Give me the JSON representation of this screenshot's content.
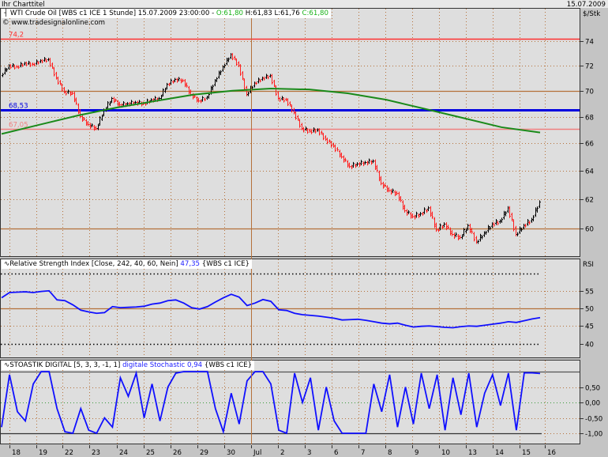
{
  "window": {
    "title": "Ihr Charttitel",
    "date": "15.07.2009"
  },
  "main_legend": {
    "icon": "candlestick-icon",
    "instrument": "WTI Crude Oil [WBS c1 ICE  1 Stunde] 15.07.2009 23:00:00 -",
    "open": "O:61,80",
    "high_low": "H:61,83 L:61,76",
    "close": "C:61,80",
    "copyright": "© www.tradesignalonline.com"
  },
  "rsi_legend": {
    "name": "Relative Strength Index [Close, 242, 40, 60, Nein]",
    "value": "47,35",
    "source": "{WBS c1 ICE}"
  },
  "stoch_legend": {
    "name": "STOASTIK DIGITAL [5, 3, 3, -1, 1]",
    "value": "digitale Stochastic 0,94",
    "source": "{WBS c1 ICE}"
  },
  "colors": {
    "up": "#000000",
    "down": "#ff2020",
    "ma": "#1a8a1a",
    "level_blue": "#0000e0",
    "level_red": "#ff3030",
    "level_pink": "#f08080",
    "brown": "#b5713a",
    "indicator": "#1010ff"
  },
  "chart_data": [
    {
      "type": "ohlc",
      "title": "WTI Crude Oil [WBS c1 ICE 1 Stunde]",
      "ylabel": "$/Stk",
      "yscale": "log",
      "ylim": [
        58.6,
        75.2
      ],
      "yticks": [
        "74",
        "72",
        "70",
        "68",
        "66",
        "64",
        "62",
        "60"
      ],
      "ytick_values": [
        74,
        72,
        70,
        68,
        66,
        64,
        62,
        60
      ],
      "x_labels": [
        "18",
        "19",
        "22",
        "23",
        "24",
        "25",
        "26",
        "29",
        "30",
        "Jul",
        "2",
        "3",
        "6",
        "7",
        "8",
        "9",
        "10",
        "13",
        "14",
        "15",
        "16"
      ],
      "closes": [
        71.2,
        72.0,
        71.9,
        72.2,
        72.1,
        72.4,
        72.5,
        71.0,
        69.9,
        69.8,
        68.0,
        67.4,
        67.1,
        68.5,
        69.4,
        68.9,
        69.0,
        69.1,
        69.0,
        69.3,
        69.4,
        70.5,
        70.9,
        70.8,
        69.7,
        69.2,
        69.5,
        70.8,
        71.9,
        72.9,
        72.0,
        69.7,
        70.6,
        71.0,
        71.2,
        69.4,
        69.3,
        68.3,
        67.1,
        66.9,
        67.0,
        66.3,
        65.8,
        65.0,
        64.3,
        64.5,
        64.6,
        64.7,
        63.1,
        62.6,
        62.4,
        61.2,
        60.8,
        61.0,
        61.4,
        59.9,
        60.3,
        59.6,
        59.4,
        60.2,
        59.1,
        59.7,
        60.3,
        60.5,
        61.4,
        59.6,
        60.2,
        60.6,
        61.8
      ],
      "moving_average": [
        66.7,
        67.4,
        68.1,
        68.7,
        69.2,
        69.7,
        70.0,
        70.17,
        70.1,
        69.8,
        69.3,
        68.6,
        67.9,
        67.2,
        66.8
      ],
      "levels": [
        {
          "value": 74.2,
          "label": "74,2",
          "color": "#ff3030"
        },
        {
          "value": 68.53,
          "label": "68,53",
          "color": "#0000e0"
        },
        {
          "value": 67.05,
          "label": "67,05",
          "color": "#f08080"
        }
      ],
      "brown_lines": [
        70,
        60
      ]
    },
    {
      "type": "line",
      "title": "Relative Strength Index",
      "ylabel": "RSI",
      "ylim": [
        36,
        63
      ],
      "yticks": [
        "55",
        "50",
        "45",
        "40"
      ],
      "ytick_values": [
        55,
        50,
        45,
        40
      ],
      "bands": [
        60,
        40
      ],
      "midline": 50,
      "values": [
        53,
        54.5,
        54.6,
        54.7,
        54.5,
        54.8,
        55,
        52.4,
        52.2,
        51,
        49.5,
        49,
        48.6,
        48.8,
        50.5,
        50.2,
        50.3,
        50.4,
        50.6,
        51.2,
        51.5,
        52.2,
        52.4,
        51.5,
        50.2,
        49.8,
        50.5,
        51.8,
        53,
        54,
        53.2,
        50.8,
        51.5,
        52.5,
        52,
        49.6,
        49.4,
        48.6,
        48.2,
        48,
        47.8,
        47.5,
        47.2,
        46.7,
        46.8,
        46.9,
        46.6,
        46.2,
        45.8,
        45.6,
        45.8,
        45.2,
        44.7,
        44.9,
        45,
        44.8,
        44.6,
        44.5,
        44.8,
        45,
        44.9,
        45.2,
        45.5,
        45.8,
        46.2,
        46,
        46.5,
        47,
        47.35
      ]
    },
    {
      "type": "line",
      "title": "digitale Stochastic",
      "ylim": [
        -1.3,
        1.4
      ],
      "yticks": [
        "0,50",
        "0,00",
        "-0,50",
        "-1,00"
      ],
      "ytick_values": [
        0.5,
        0,
        -0.5,
        -1
      ],
      "values": [
        -0.8,
        0.9,
        -0.3,
        -0.6,
        0.6,
        1.0,
        1.0,
        -0.2,
        -0.95,
        -1.0,
        -0.2,
        -0.9,
        -1.0,
        -0.5,
        -0.8,
        0.8,
        0.2,
        0.95,
        -0.5,
        0.6,
        -0.6,
        0.5,
        0.95,
        1.0,
        1.0,
        1.0,
        1.0,
        -0.2,
        -0.95,
        0.3,
        -0.7,
        0.7,
        1.0,
        1.0,
        0.6,
        -0.9,
        -1.0,
        0.95,
        0.0,
        0.8,
        -0.9,
        0.5,
        -0.6,
        -1.0,
        -1.0,
        -1.0,
        -1.0,
        0.6,
        -0.3,
        0.9,
        -0.8,
        0.5,
        -0.7,
        0.95,
        -0.2,
        0.9,
        -0.9,
        0.8,
        -0.4,
        0.95,
        -0.8,
        0.3,
        0.9,
        -0.1,
        0.95,
        -0.9,
        0.96,
        0.96,
        0.94
      ]
    }
  ]
}
